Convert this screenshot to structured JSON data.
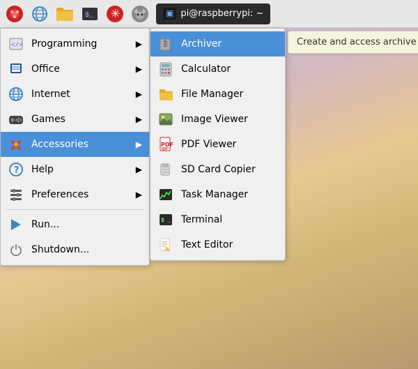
{
  "taskbar": {
    "icons": [
      {
        "name": "raspberry-icon",
        "symbol": "🍓",
        "label": "Raspberry Pi"
      },
      {
        "name": "globe-icon",
        "symbol": "🌐",
        "label": "Browser"
      },
      {
        "name": "folder-icon",
        "symbol": "📁",
        "label": "Files"
      },
      {
        "name": "terminal-icon",
        "symbol": "▣",
        "label": "Terminal"
      },
      {
        "name": "asterisk-icon",
        "symbol": "✳",
        "label": "Featured"
      },
      {
        "name": "wolf-icon",
        "symbol": "🐺",
        "label": "VPN"
      }
    ],
    "terminal_label": "pi@raspberrypi: ~"
  },
  "main_menu": {
    "items": [
      {
        "id": "programming",
        "label": "Programming",
        "has_arrow": true
      },
      {
        "id": "office",
        "label": "Office",
        "has_arrow": true
      },
      {
        "id": "internet",
        "label": "Internet",
        "has_arrow": true
      },
      {
        "id": "games",
        "label": "Games",
        "has_arrow": true
      },
      {
        "id": "accessories",
        "label": "Accessories",
        "has_arrow": true,
        "active": true
      },
      {
        "id": "help",
        "label": "Help",
        "has_arrow": true
      },
      {
        "id": "preferences",
        "label": "Preferences",
        "has_arrow": true
      },
      {
        "id": "run",
        "label": "Run...",
        "has_arrow": false
      },
      {
        "id": "shutdown",
        "label": "Shutdown...",
        "has_arrow": false
      }
    ]
  },
  "accessories_submenu": {
    "items": [
      {
        "id": "archiver",
        "label": "Archiver",
        "active": true
      },
      {
        "id": "calculator",
        "label": "Calculator"
      },
      {
        "id": "file-manager",
        "label": "File Manager"
      },
      {
        "id": "image-viewer",
        "label": "Image Viewer"
      },
      {
        "id": "pdf-viewer",
        "label": "PDF Viewer"
      },
      {
        "id": "sd-card-copier",
        "label": "SD Card Copier"
      },
      {
        "id": "task-manager",
        "label": "Task Manager"
      },
      {
        "id": "terminal",
        "label": "Terminal"
      },
      {
        "id": "text-editor",
        "label": "Text Editor"
      }
    ]
  },
  "tooltip": {
    "text": "Create and access archive files"
  }
}
